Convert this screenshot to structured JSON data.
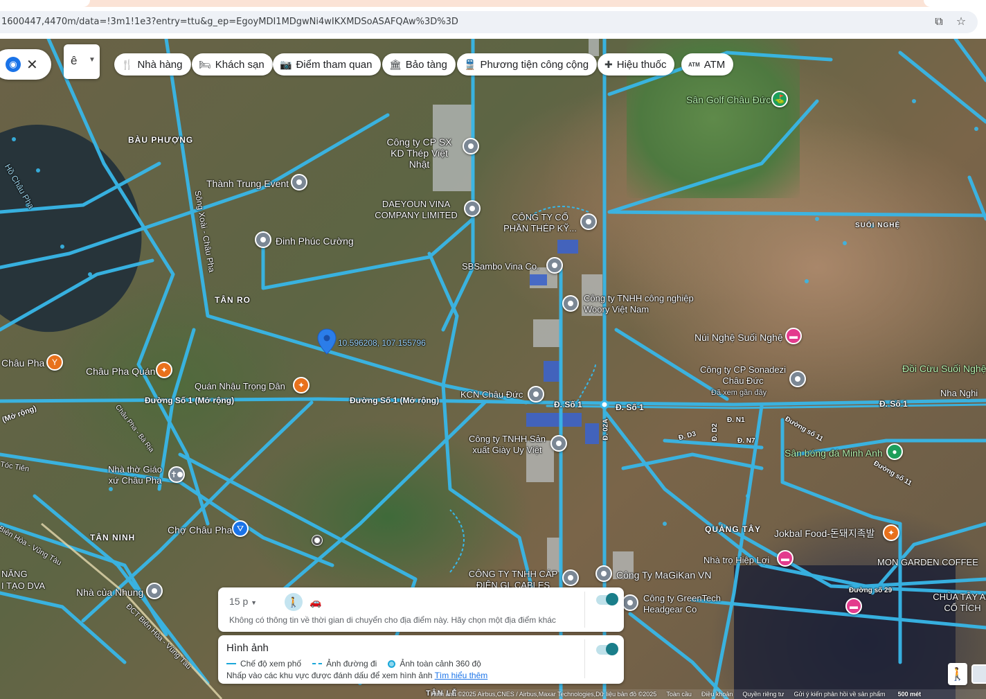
{
  "browser": {
    "url": "1600447,4470m/data=!3m1!1e3?entry=ttu&g_ep=EgoyMDI1MDgwNi4wIKXMDSoASAFQAw%3D%3D",
    "icons": [
      "install-app-icon",
      "bookmark-star-icon"
    ]
  },
  "search": {
    "language_value": "ê"
  },
  "chips": [
    {
      "label": "Nhà hàng",
      "icon": "restaurant-icon"
    },
    {
      "label": "Khách sạn",
      "icon": "hotel-icon"
    },
    {
      "label": "Điểm tham quan",
      "icon": "camera-icon"
    },
    {
      "label": "Bảo tàng",
      "icon": "museum-icon"
    },
    {
      "label": "Phương tiện công cộng",
      "icon": "transit-icon"
    },
    {
      "label": "Hiệu thuốc",
      "icon": "pharmacy-icon"
    },
    {
      "label": "ATM",
      "icon": "atm-icon"
    }
  ],
  "map": {
    "coordinate_label": "10.596208, 107.155796",
    "areas": [
      "BÀU PHƯỢNG",
      "TÂN RO",
      "TÂN NINH",
      "QUẢNG TÂY",
      "SUỐI NGHỆ"
    ],
    "water_labels": [
      "Hồ Châu Pha",
      "Sông Xoài - Châu Pha"
    ],
    "roads": [
      "Đường Số 1 (Mở rộng)",
      "Đường Số 1 (Mở rộng)",
      "Đ. Số 1",
      "Đ. Số 1",
      "Đ. Số 1",
      "Đ. 02A",
      "Đ. N1",
      "Đ. N7",
      "Đ. D3",
      "Đ. D2",
      "Đường số 11",
      "Đường số 11",
      "Đường số 29",
      "Châu Pha - Bà Rịa",
      "Tóc Tiên",
      "Biên Hòa - Vũng Tàu",
      "ĐCT Biên Hòa - Vũng Tàu",
      "(Mở rộng)"
    ],
    "places": [
      "Thành Trung Event",
      "Đinh Phúc Cường",
      "Công ty CP SX KD Thép Việt Nhật",
      "DAEYOUN VINA COMPANY LIMITED",
      "CÔNG TY CỔ PHẦN THÉP KỸ...",
      "SBSambo Vina Co.",
      "Công ty TNHH công nghiệp Woory Việt Nam",
      "Núi Nghệ Suối Nghệ",
      "Công ty CP Sonadezi Châu Đức",
      "KCN Châu Đức",
      "Công ty TNHH Sản xuất Giày Uy Việt",
      "Sân bóng đá Minh Anh",
      "Châu Pha",
      "Châu Pha Quán",
      "Quán Nhậu Trọng Dân",
      "Nhà thờ Giáo xứ Châu Pha",
      "Chợ Châu Pha",
      "Nhà của Nhung",
      "CÔNG TY TNHH CÁP ĐIỆN GL CABLES",
      "Công Ty MaGiKan VN",
      "Công ty GreenTech Headgear Co",
      "Nhà trọ Hiệp Lợi",
      "Jokbal Food-돈돼지족발",
      "MON GARDEN COFFEE",
      "CHÙA TÂY AN CỔ TÍCH",
      "Sân Golf Châu Đức",
      "Đồi Cừu Suối Nghệ",
      "Nha Nghi",
      "NĂNG",
      "I TẠO DVA",
      "TÂN LỄ"
    ],
    "sonadezi_sub": "Đã xem gần đây"
  },
  "travel_panel": {
    "time_select": "15 p",
    "note": "Không có thông tin về thời gian di chuyển cho địa điểm này. Hãy chọn một địa điểm khác"
  },
  "images_panel": {
    "title": "Hình ảnh",
    "legend": [
      "Chế độ xem phố",
      "Ảnh đường đi",
      "Ảnh toàn cảnh 360 độ"
    ],
    "hint": "Nhấp vào các khu vực được đánh dấu để xem hình ảnh",
    "learn_more": "Tìm hiểu thêm"
  },
  "footer": {
    "attribution": "Hình ảnh ©2025 Airbus,CNES / Airbus,Maxar Technologies,Dữ liệu bản đồ ©2025",
    "links": [
      "Toàn cầu",
      "Điều khoản",
      "Quyền riêng tư",
      "Gửi ý kiến phản hồi về sản phẩm"
    ],
    "scale": "500 mét"
  }
}
